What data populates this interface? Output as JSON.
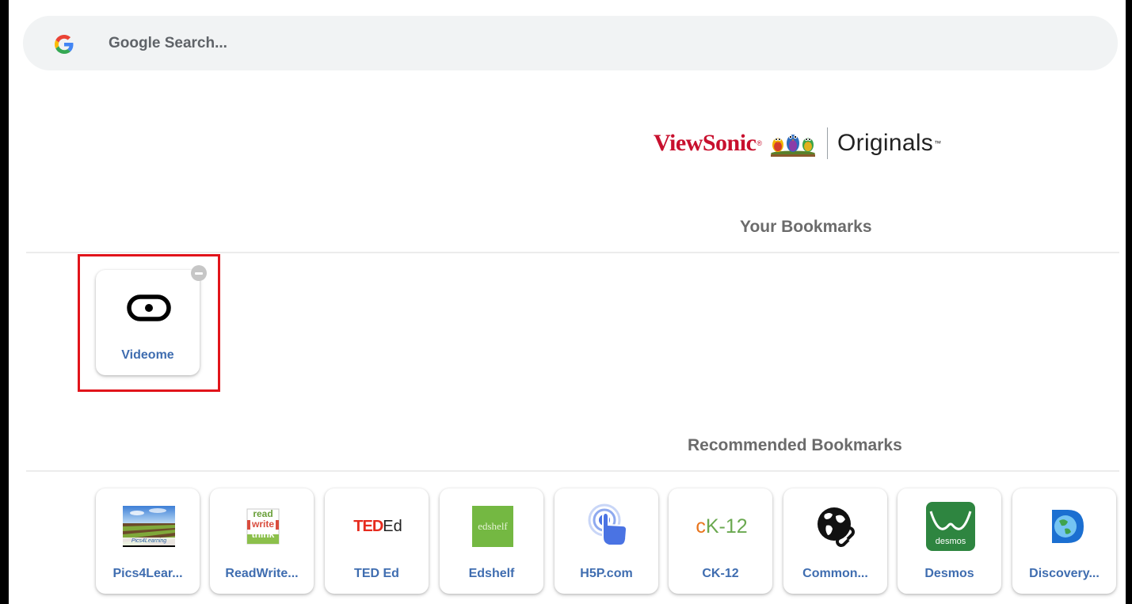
{
  "search": {
    "placeholder": "Google Search...",
    "icon": "google-g-icon"
  },
  "logo": {
    "brand": "ViewSonic",
    "reg_mark": "®",
    "product": "Originals",
    "tm_mark": "™"
  },
  "sections": {
    "your_bookmarks": "Your Bookmarks",
    "recommended_bookmarks": "Recommended Bookmarks"
  },
  "your_bookmarks": [
    {
      "label": "Videome",
      "icon": "videome-icon"
    }
  ],
  "recommended": [
    {
      "label": "Pics4Lear...",
      "icon": "pics4learning-icon",
      "logo_text": "Pics4Learning"
    },
    {
      "label": "ReadWrite...",
      "icon": "readwritethink-icon",
      "logo_text_1": "read",
      "logo_text_2": "write",
      "logo_text_3": "think"
    },
    {
      "label": "TED Ed",
      "icon": "ted-ed-icon",
      "logo_text_1": "TED",
      "logo_text_2": "Ed"
    },
    {
      "label": "Edshelf",
      "icon": "edshelf-icon",
      "logo_text": "edshelf"
    },
    {
      "label": "H5P.com",
      "icon": "h5p-icon"
    },
    {
      "label": "CK-12",
      "icon": "ck12-icon",
      "logo_text_1": "c",
      "logo_text_2": "K",
      "logo_text_3": "-12"
    },
    {
      "label": "Common...",
      "icon": "common-sense-globe-icon"
    },
    {
      "label": "Desmos",
      "icon": "desmos-icon",
      "logo_text": "desmos"
    },
    {
      "label": "Discovery...",
      "icon": "discovery-icon"
    }
  ],
  "colors": {
    "accent_label": "#3f6db0",
    "brand_red": "#c8102e",
    "highlight": "#e1141b"
  }
}
